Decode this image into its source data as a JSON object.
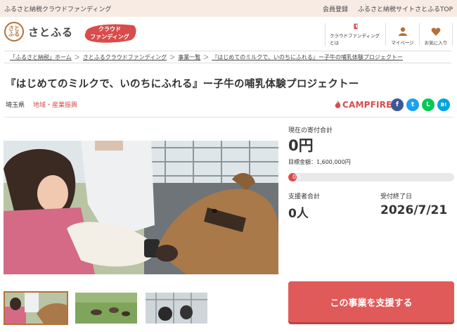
{
  "topbar": {
    "site_label": "ふるさと納税クラウドファンディング",
    "member_register": "会員登録",
    "top_link": "ふるさと納税サイトさとふるTOP"
  },
  "header": {
    "logo_text": "さとふる",
    "logo_mark": "さと\nふる",
    "badge_line1": "クラウド",
    "badge_line2": "ファンディング",
    "nav": [
      {
        "label": "クラウドファンディングとは",
        "icon": "book-icon"
      },
      {
        "label": "マイページ",
        "icon": "user-icon"
      },
      {
        "label": "お気に入り",
        "icon": "heart-icon"
      }
    ]
  },
  "breadcrumb": [
    "「ふるさと納税」ホーム",
    "さとふるクラウドファンディング",
    "事業一覧",
    "『はじめてのミルクで、いのちにふれる』ー子牛の哺乳体験プロジェクトー"
  ],
  "breadcrumb_sep": "＞",
  "project": {
    "title": "『はじめてのミルクで、いのちにふれる』ー子牛の哺乳体験プロジェクトー",
    "prefecture": "埼玉県",
    "category": "地域・産業振興",
    "platform": "CAMPFIRE"
  },
  "social": [
    {
      "name": "facebook",
      "glyph": "f",
      "color": "#3b5998"
    },
    {
      "name": "twitter",
      "glyph": "t",
      "color": "#1da1f2"
    },
    {
      "name": "line",
      "glyph": "L",
      "color": "#06c755"
    },
    {
      "name": "hatena",
      "glyph": "B!",
      "color": "#00a4de"
    }
  ],
  "funding": {
    "current_label": "現在の寄付合計",
    "current_amount": "0円",
    "goal_text": "目標金額：1,600,000円",
    "progress_text": "0%",
    "progress": 0,
    "supporters_label": "支援者合計",
    "supporters_value": "0人",
    "end_label": "受付終了日",
    "end_value": "2026/7/21"
  },
  "support_button": "この事業を支援する",
  "colors": {
    "accent": "#e05a5a",
    "brand_brown": "#b5713a",
    "topbar_bg": "#f7ebe4"
  }
}
